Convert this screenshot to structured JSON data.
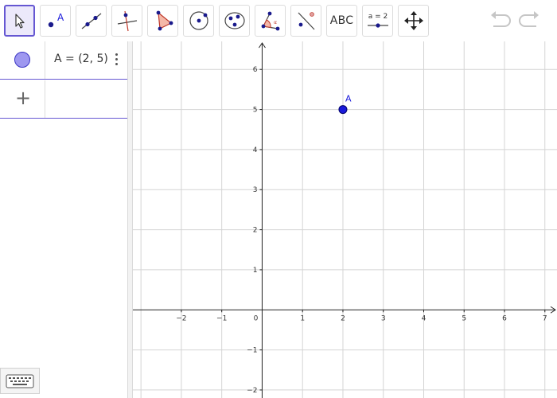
{
  "toolbar": {
    "tools": [
      {
        "name": "move-tool"
      },
      {
        "name": "point-tool",
        "label": "A"
      },
      {
        "name": "line-tool"
      },
      {
        "name": "perpendicular-line-tool"
      },
      {
        "name": "polygon-tool"
      },
      {
        "name": "circle-center-point-tool"
      },
      {
        "name": "circle-three-points-tool"
      },
      {
        "name": "angle-tool"
      },
      {
        "name": "reflect-tool"
      },
      {
        "name": "text-tool",
        "label": "ABC"
      },
      {
        "name": "slider-tool",
        "label": "a = 2"
      },
      {
        "name": "move-graphics-view-tool"
      }
    ],
    "active_tool": "move-tool",
    "undo_icon": "undo-icon",
    "redo_icon": "redo-icon"
  },
  "algebra": {
    "items": [
      {
        "definition": "A = (2, 5)",
        "color": "#3b36c4"
      }
    ],
    "add_symbol": "+"
  },
  "graphics": {
    "x_ticks": [
      "−2",
      "−1",
      "0",
      "1",
      "2",
      "3",
      "4",
      "5",
      "6",
      "7"
    ],
    "y_ticks": [
      "6",
      "5",
      "4",
      "3",
      "2",
      "1",
      "−1",
      "−2"
    ],
    "x_range": [
      -3.2,
      7.3
    ],
    "y_range": [
      -2.2,
      6.7
    ],
    "grid": true,
    "points": [
      {
        "label": "A",
        "x": 2,
        "y": 5,
        "color": "#1a1adb"
      }
    ]
  },
  "colors": {
    "accent": "#6557d2",
    "point": "#1a1adb",
    "grid": "#d4d4d4"
  }
}
